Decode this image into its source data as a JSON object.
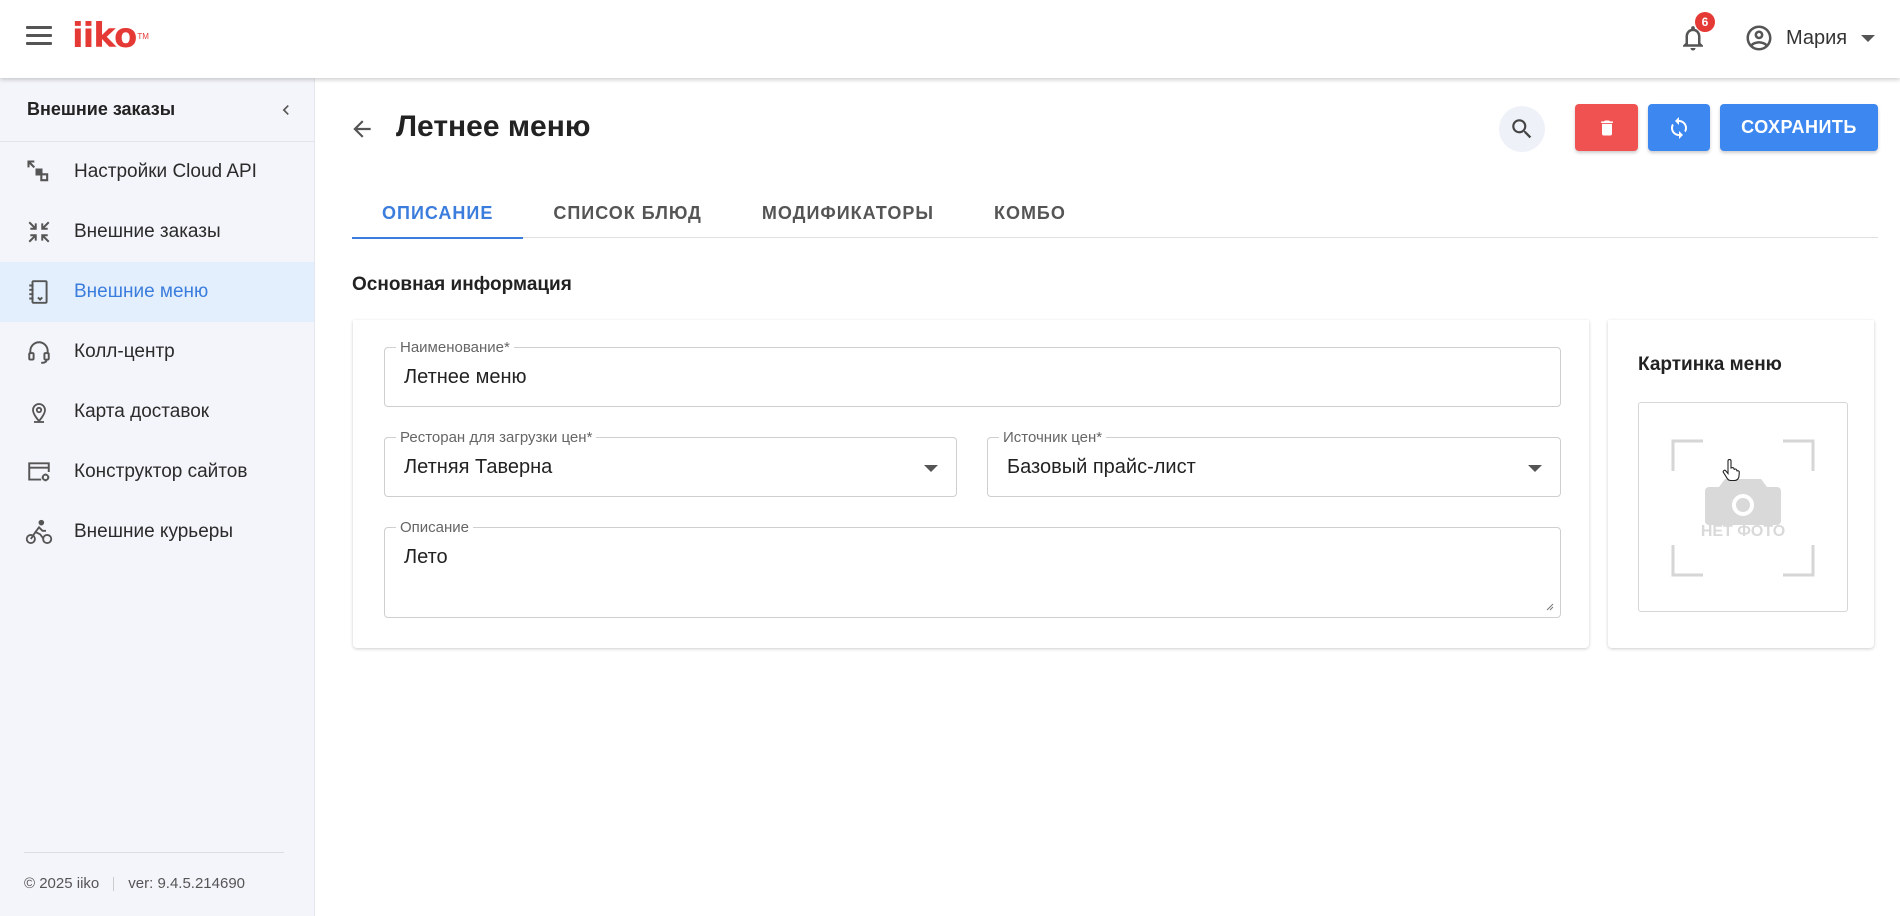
{
  "header": {
    "logo": "iiko",
    "logo_tm": "TM",
    "notifications_count": "6",
    "user_name": "Мария"
  },
  "sidebar": {
    "title": "Внешние заказы",
    "items": [
      {
        "label": "Настройки Cloud API",
        "icon": "cloud-api-settings-icon"
      },
      {
        "label": "Внешние заказы",
        "icon": "external-orders-icon"
      },
      {
        "label": "Внешние меню",
        "icon": "external-menu-icon",
        "active": true
      },
      {
        "label": "Колл-центр",
        "icon": "headset-icon"
      },
      {
        "label": "Карта доставок",
        "icon": "map-pin-icon"
      },
      {
        "label": "Конструктор сайтов",
        "icon": "site-builder-icon"
      },
      {
        "label": "Внешние курьеры",
        "icon": "courier-bike-icon"
      }
    ],
    "footer": {
      "copyright": "© 2025 iiko",
      "version": "ver: 9.4.5.214690"
    }
  },
  "page": {
    "title": "Летнее меню",
    "save_label": "СОХРАНИТЬ",
    "tabs": [
      {
        "label": "ОПИСАНИЕ",
        "active": true
      },
      {
        "label": "СПИСОК БЛЮД"
      },
      {
        "label": "МОДИФИКАТОРЫ"
      },
      {
        "label": "КОМБО"
      }
    ],
    "section_title": "Основная информация",
    "form": {
      "name_label": "Наименование*",
      "name_value": "Летнее меню",
      "restaurant_label": "Ресторан для загрузки цен*",
      "restaurant_value": "Летняя Таверна",
      "price_source_label": "Источник цен*",
      "price_source_value": "Базовый прайс-лист",
      "description_label": "Описание",
      "description_value": "Лето"
    },
    "picture": {
      "title": "Картинка меню",
      "no_photo": "НЕТ ФОТО"
    }
  },
  "colors": {
    "accent": "#3b7ddd",
    "primary_button": "#3d87f0",
    "danger_button": "#f05252",
    "logo": "#e53935",
    "active_nav_bg": "#e3effd",
    "sidebar_bg": "#f4f5fa"
  }
}
